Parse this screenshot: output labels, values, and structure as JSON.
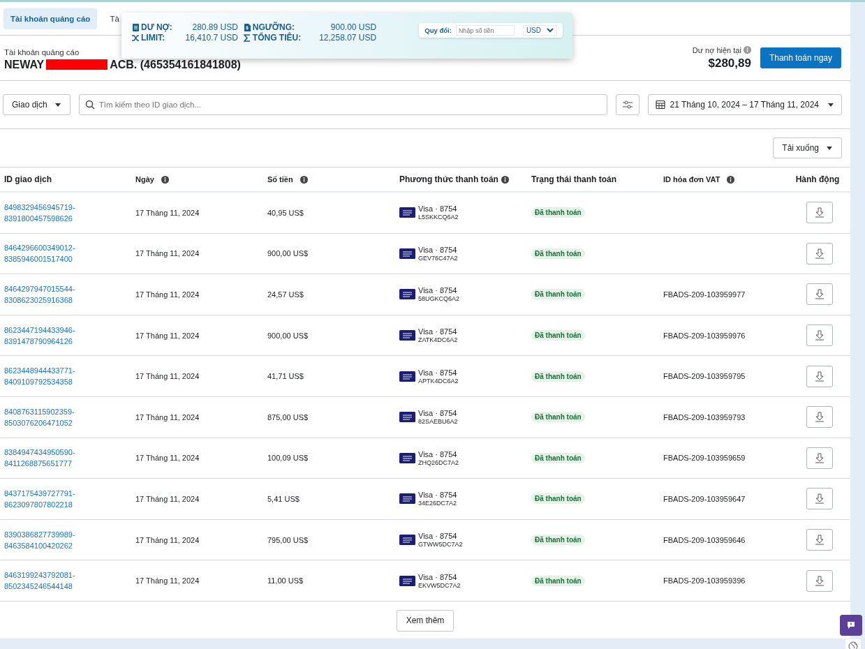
{
  "tabs": [
    {
      "label": "Tài khoản quảng cáo",
      "selected": true
    },
    {
      "label": "Tà",
      "selected": false
    }
  ],
  "summary": {
    "items": [
      {
        "kind": "debt",
        "label": "DƯ NỢ:",
        "value": "280.89 USD"
      },
      {
        "kind": "threshold",
        "label": "NGƯỠNG:",
        "value": "900.00 USD"
      },
      {
        "kind": "limit",
        "label": "LIMIT:",
        "value": "16,410.7 USD"
      },
      {
        "kind": "total",
        "label": "TỔNG TIÊU:",
        "value": "12,258.07 USD"
      }
    ],
    "convert_label": "Quy đổi:",
    "amount_placeholder": "Nhập số tiền",
    "currency": "USD"
  },
  "account": {
    "caption": "Tài khoản quảng cáo",
    "name_start": "NEWAY",
    "name_end": "ACB. (465354161841808)",
    "balance_label": "Dư nợ hiện tại",
    "balance": "$280,89",
    "pay_button": "Thanh toán ngay"
  },
  "toolbar": {
    "type_filter": "Giao dịch",
    "search_placeholder": "Tìm kiếm theo ID giao dịch...",
    "date_range": "21 Tháng 10, 2024 – 17 Tháng 11, 2024",
    "download": "Tải xuống"
  },
  "table": {
    "columns": [
      {
        "label": "ID giao dịch",
        "info": false
      },
      {
        "label": "Ngày",
        "info": true
      },
      {
        "label": "Số tiền",
        "info": true
      },
      {
        "label": "Phương thức thanh toán",
        "info": true
      },
      {
        "label": "Trạng thái thanh toán",
        "info": false
      },
      {
        "label": "ID hóa đơn VAT",
        "info": true
      },
      {
        "label": "Hành động",
        "info": false
      }
    ],
    "rows": [
      {
        "id": [
          "8498329456945719-",
          "8391800457598626"
        ],
        "date": "17 Tháng 11, 2024",
        "amount": "40,95 US$",
        "card": "Visa · 8754",
        "ref": "L5SKKCQ6A2",
        "status": "Đã thanh toán"
      },
      {
        "id": [
          "8464296600349012-",
          "8385946001517400"
        ],
        "date": "17 Tháng 11, 2024",
        "amount": "900,00 US$",
        "card": "Visa · 8754",
        "ref": "GEV76C47A2",
        "status": "Đã thanh toán"
      },
      {
        "id": [
          "8464297947015544-",
          "8308623025916368"
        ],
        "date": "17 Tháng 11, 2024",
        "amount": "24,57 US$",
        "card": "Visa · 8754",
        "ref": "58UGKCQ6A2",
        "status": "Đã thanh toán",
        "vat": "FBADS-209-103959977"
      },
      {
        "id": [
          "8623447194433946-",
          "8391478790964126"
        ],
        "date": "17 Tháng 11, 2024",
        "amount": "900,00 US$",
        "card": "Visa · 8754",
        "ref": "ZATK4DC6A2",
        "status": "Đã thanh toán",
        "vat": "FBADS-209-103959976"
      },
      {
        "id": [
          "8623448944433771-",
          "8409109792534358"
        ],
        "date": "17 Tháng 11, 2024",
        "amount": "41,71 US$",
        "card": "Visa · 8754",
        "ref": "APTK4DC6A2",
        "status": "Đã thanh toán",
        "vat": "FBADS-209-103959795"
      },
      {
        "id": [
          "8408763115902359-",
          "8503076206471052"
        ],
        "date": "17 Tháng 11, 2024",
        "amount": "875,00 US$",
        "card": "Visa · 8754",
        "ref": "82SAEBU6A2",
        "status": "Đã thanh toán",
        "vat": "FBADS-209-103959793"
      },
      {
        "id": [
          "8384947434950590-",
          "8411268875651777"
        ],
        "date": "17 Tháng 11, 2024",
        "amount": "100,09 US$",
        "card": "Visa · 8754",
        "ref": "ZHQ26DC7A2",
        "status": "Đã thanh toán",
        "vat": "FBADS-209-103959659"
      },
      {
        "id": [
          "8437175439727791-",
          "8623097807802218"
        ],
        "date": "17 Tháng 11, 2024",
        "amount": "5,41 US$",
        "card": "Visa · 8754",
        "ref": "34E26DC7A2",
        "status": "Đã thanh toán",
        "vat": "FBADS-209-103959647"
      },
      {
        "id": [
          "8390386827739989-",
          "8463584100420262"
        ],
        "date": "17 Tháng 11, 2024",
        "amount": "795,00 US$",
        "card": "Visa · 8754",
        "ref": "GTWW5DC7A2",
        "status": "Đã thanh toán",
        "vat": "FBADS-209-103959646"
      },
      {
        "id": [
          "8463199243792081-",
          "8502345246544148"
        ],
        "date": "17 Tháng 11, 2024",
        "amount": "11,00 US$",
        "card": "Visa · 8754",
        "ref": "EKVW5DC7A2",
        "status": "Đã thanh toán",
        "vat": "FBADS-209-103959396"
      }
    ]
  },
  "more_button": "Xem thêm"
}
